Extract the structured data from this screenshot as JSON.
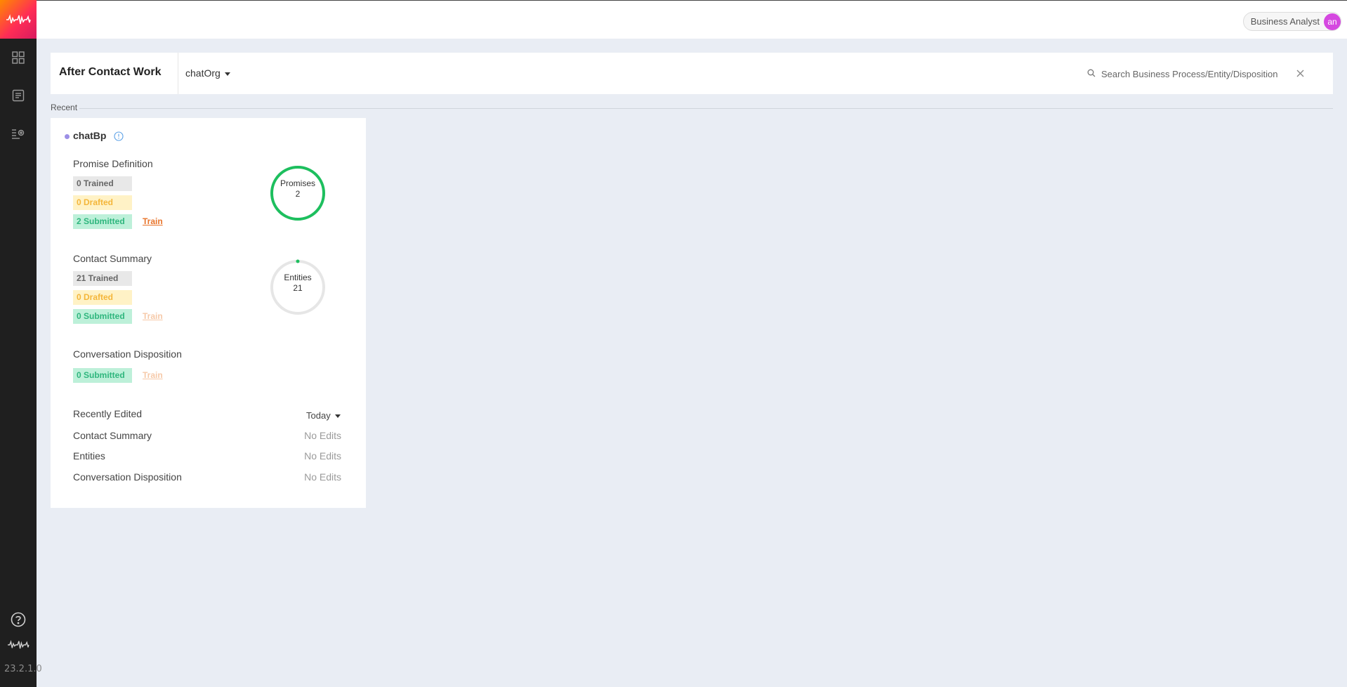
{
  "app": {
    "version": "23.2.1.0"
  },
  "header": {
    "role": "Business Analyst",
    "avatar_initials": "an"
  },
  "page": {
    "title": "After Contact Work",
    "org": "chatOrg",
    "search_placeholder": "Search Business Process/Entity/Disposition",
    "recent_label": "Recent"
  },
  "card": {
    "name": "chatBp",
    "promise": {
      "title": "Promise Definition",
      "trained": "0 Trained",
      "drafted": "0 Drafted",
      "submitted": "2 Submitted",
      "train": "Train",
      "ring_label": "Promises",
      "ring_value": "2",
      "ring_progress": 1.0
    },
    "summary": {
      "title": "Contact Summary",
      "trained": "21 Trained",
      "drafted": "0 Drafted",
      "submitted": "0 Submitted",
      "train": "Train",
      "ring_label": "Entities",
      "ring_value": "21",
      "ring_progress": 0.0
    },
    "disposition": {
      "title": "Conversation Disposition",
      "submitted": "0 Submitted",
      "train": "Train"
    },
    "recently_edited": {
      "title": "Recently Edited",
      "filter": "Today",
      "rows": [
        {
          "label": "Contact Summary",
          "value": "No Edits"
        },
        {
          "label": "Entities",
          "value": "No Edits"
        },
        {
          "label": "Conversation Disposition",
          "value": "No Edits"
        }
      ]
    }
  },
  "colors": {
    "sidebar": "#1f1f1f",
    "ring_green": "#1dbf5e",
    "ring_track": "#e6e6e6",
    "train_link": "#e8742b",
    "avatar": "#d548e0"
  },
  "icons": [
    "brand-logo-icon",
    "dashboard-icon",
    "document-icon",
    "settings-list-icon",
    "help-icon",
    "brand-wave-icon",
    "search-icon",
    "close-icon",
    "info-icon"
  ]
}
